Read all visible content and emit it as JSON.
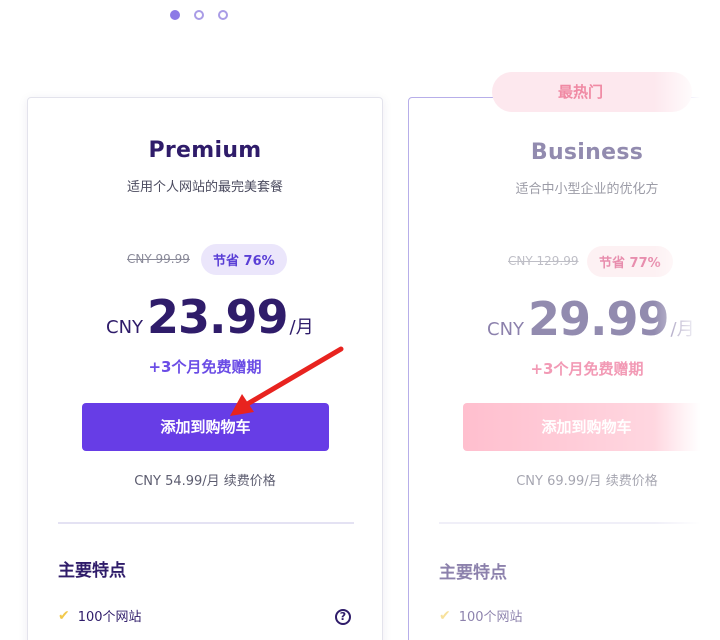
{
  "carousel": {
    "dots": 3,
    "active_index": 0
  },
  "plans": [
    {
      "name": "Premium",
      "subtitle": "适用个人网站的最完美套餐",
      "old_price": "CNY 99.99",
      "save_badge": "节省 76%",
      "currency": "CNY",
      "price": "23.99",
      "per": "/月",
      "bonus": "+3个月免费赠期",
      "cta_label": "添加到购物车",
      "renew_text": "CNY 54.99/月 续费价格",
      "features_title": "主要特点",
      "features": [
        "100个网站"
      ]
    },
    {
      "name": "Business",
      "subtitle": "适合中小型企业的优化方",
      "popular_badge": "最热门",
      "old_price": "CNY 129.99",
      "save_badge": "节省 77%",
      "currency": "CNY",
      "price": "29.99",
      "per": "/月",
      "bonus": "+3个月免费赠期",
      "cta_label": "添加到购物车",
      "renew_text": "CNY 69.99/月 续费价格",
      "features_title": "主要特点",
      "features": [
        "100个网站"
      ]
    }
  ],
  "icons": {
    "check": "check-icon",
    "help": "help-circle-icon"
  },
  "colors": {
    "primary_purple": "#673de6",
    "dark_text": "#2f1c6a",
    "pink_accent": "#e8487a",
    "check_yellow": "#f2c94c",
    "annotation_red": "#e8231f"
  }
}
